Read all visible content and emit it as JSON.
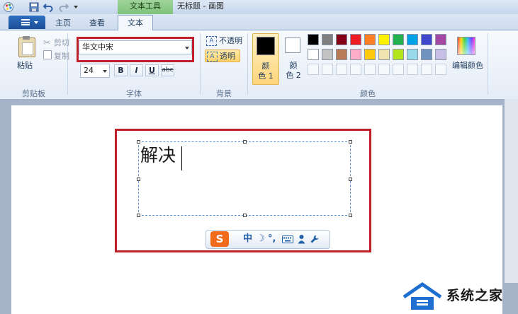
{
  "window": {
    "title": "无标题 - 画图",
    "contextual_tab_group": "文本工具"
  },
  "quick_access": {
    "icons": [
      "paint-app-icon",
      "save-icon",
      "undo-icon",
      "redo-icon",
      "customize-qat-icon"
    ]
  },
  "tabs": [
    {
      "label": "主页",
      "active": false
    },
    {
      "label": "查看",
      "active": false
    },
    {
      "label": "文本",
      "active": true
    }
  ],
  "ribbon": {
    "clipboard": {
      "group_label": "剪贴板",
      "paste_label": "粘贴",
      "cut_label": "剪切",
      "copy_label": "复制"
    },
    "font": {
      "group_label": "字体",
      "font_name": "华文中宋",
      "font_size": "24",
      "bold": "B",
      "italic": "I",
      "underline": "U",
      "strikethrough": "abc"
    },
    "background": {
      "group_label": "背景",
      "opaque_label": "不透明",
      "transparent_label": "透明",
      "selected": "transparent"
    },
    "colors": {
      "group_label": "颜色",
      "color1_label": "颜\n色 1",
      "color1_line1": "颜",
      "color1_line2": "色 1",
      "color1_value": "#000000",
      "color2_line1": "颜",
      "color2_line2": "色 2",
      "color2_value": "#ffffff",
      "edit_colors_label": "编辑颜色",
      "palette_row1": [
        "#000000",
        "#7f7f7f",
        "#880015",
        "#ed1c24",
        "#ff7f27",
        "#fff200",
        "#22b14c",
        "#00a2e8",
        "#3f48cc",
        "#a349a4"
      ],
      "palette_row2": [
        "#ffffff",
        "#c3c3c3",
        "#b97a57",
        "#ffaec9",
        "#ffc90e",
        "#efe4b0",
        "#b5e61d",
        "#99d9ea",
        "#7092be",
        "#c8bfe7"
      ]
    }
  },
  "canvas": {
    "typed_text": "解决"
  },
  "ime": {
    "logo": "S",
    "mode": "中",
    "moon": "☽",
    "punct": "°,",
    "keyboard_icon": "keyboard-icon",
    "user_icon": "user-icon",
    "wrench_icon": "wrench-icon"
  },
  "watermark": {
    "text": "系统之家"
  }
}
